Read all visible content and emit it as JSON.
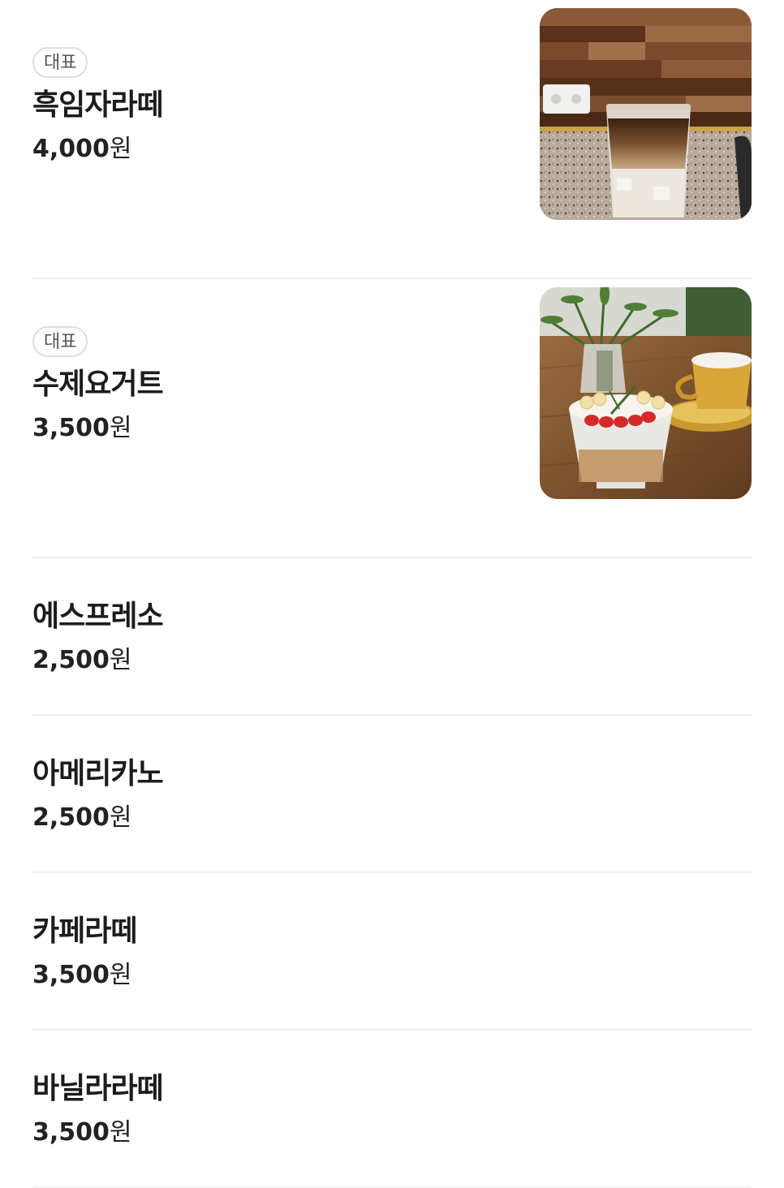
{
  "menu": {
    "items": [
      {
        "badge": "대표",
        "name": "흑임자라떼",
        "price": "4,000",
        "currency": "원",
        "photo": "iced-black-sesame-latte-photo"
      },
      {
        "badge": "대표",
        "name": "수제요거트",
        "price": "3,500",
        "currency": "원",
        "photo": "homemade-yogurt-photo"
      },
      {
        "name": "에스프레소",
        "price": "2,500",
        "currency": "원"
      },
      {
        "name": "아메리카노",
        "price": "2,500",
        "currency": "원"
      },
      {
        "name": "카페라떼",
        "price": "3,500",
        "currency": "원"
      },
      {
        "name": "바닐라라떼",
        "price": "3,500",
        "currency": "원"
      }
    ]
  }
}
